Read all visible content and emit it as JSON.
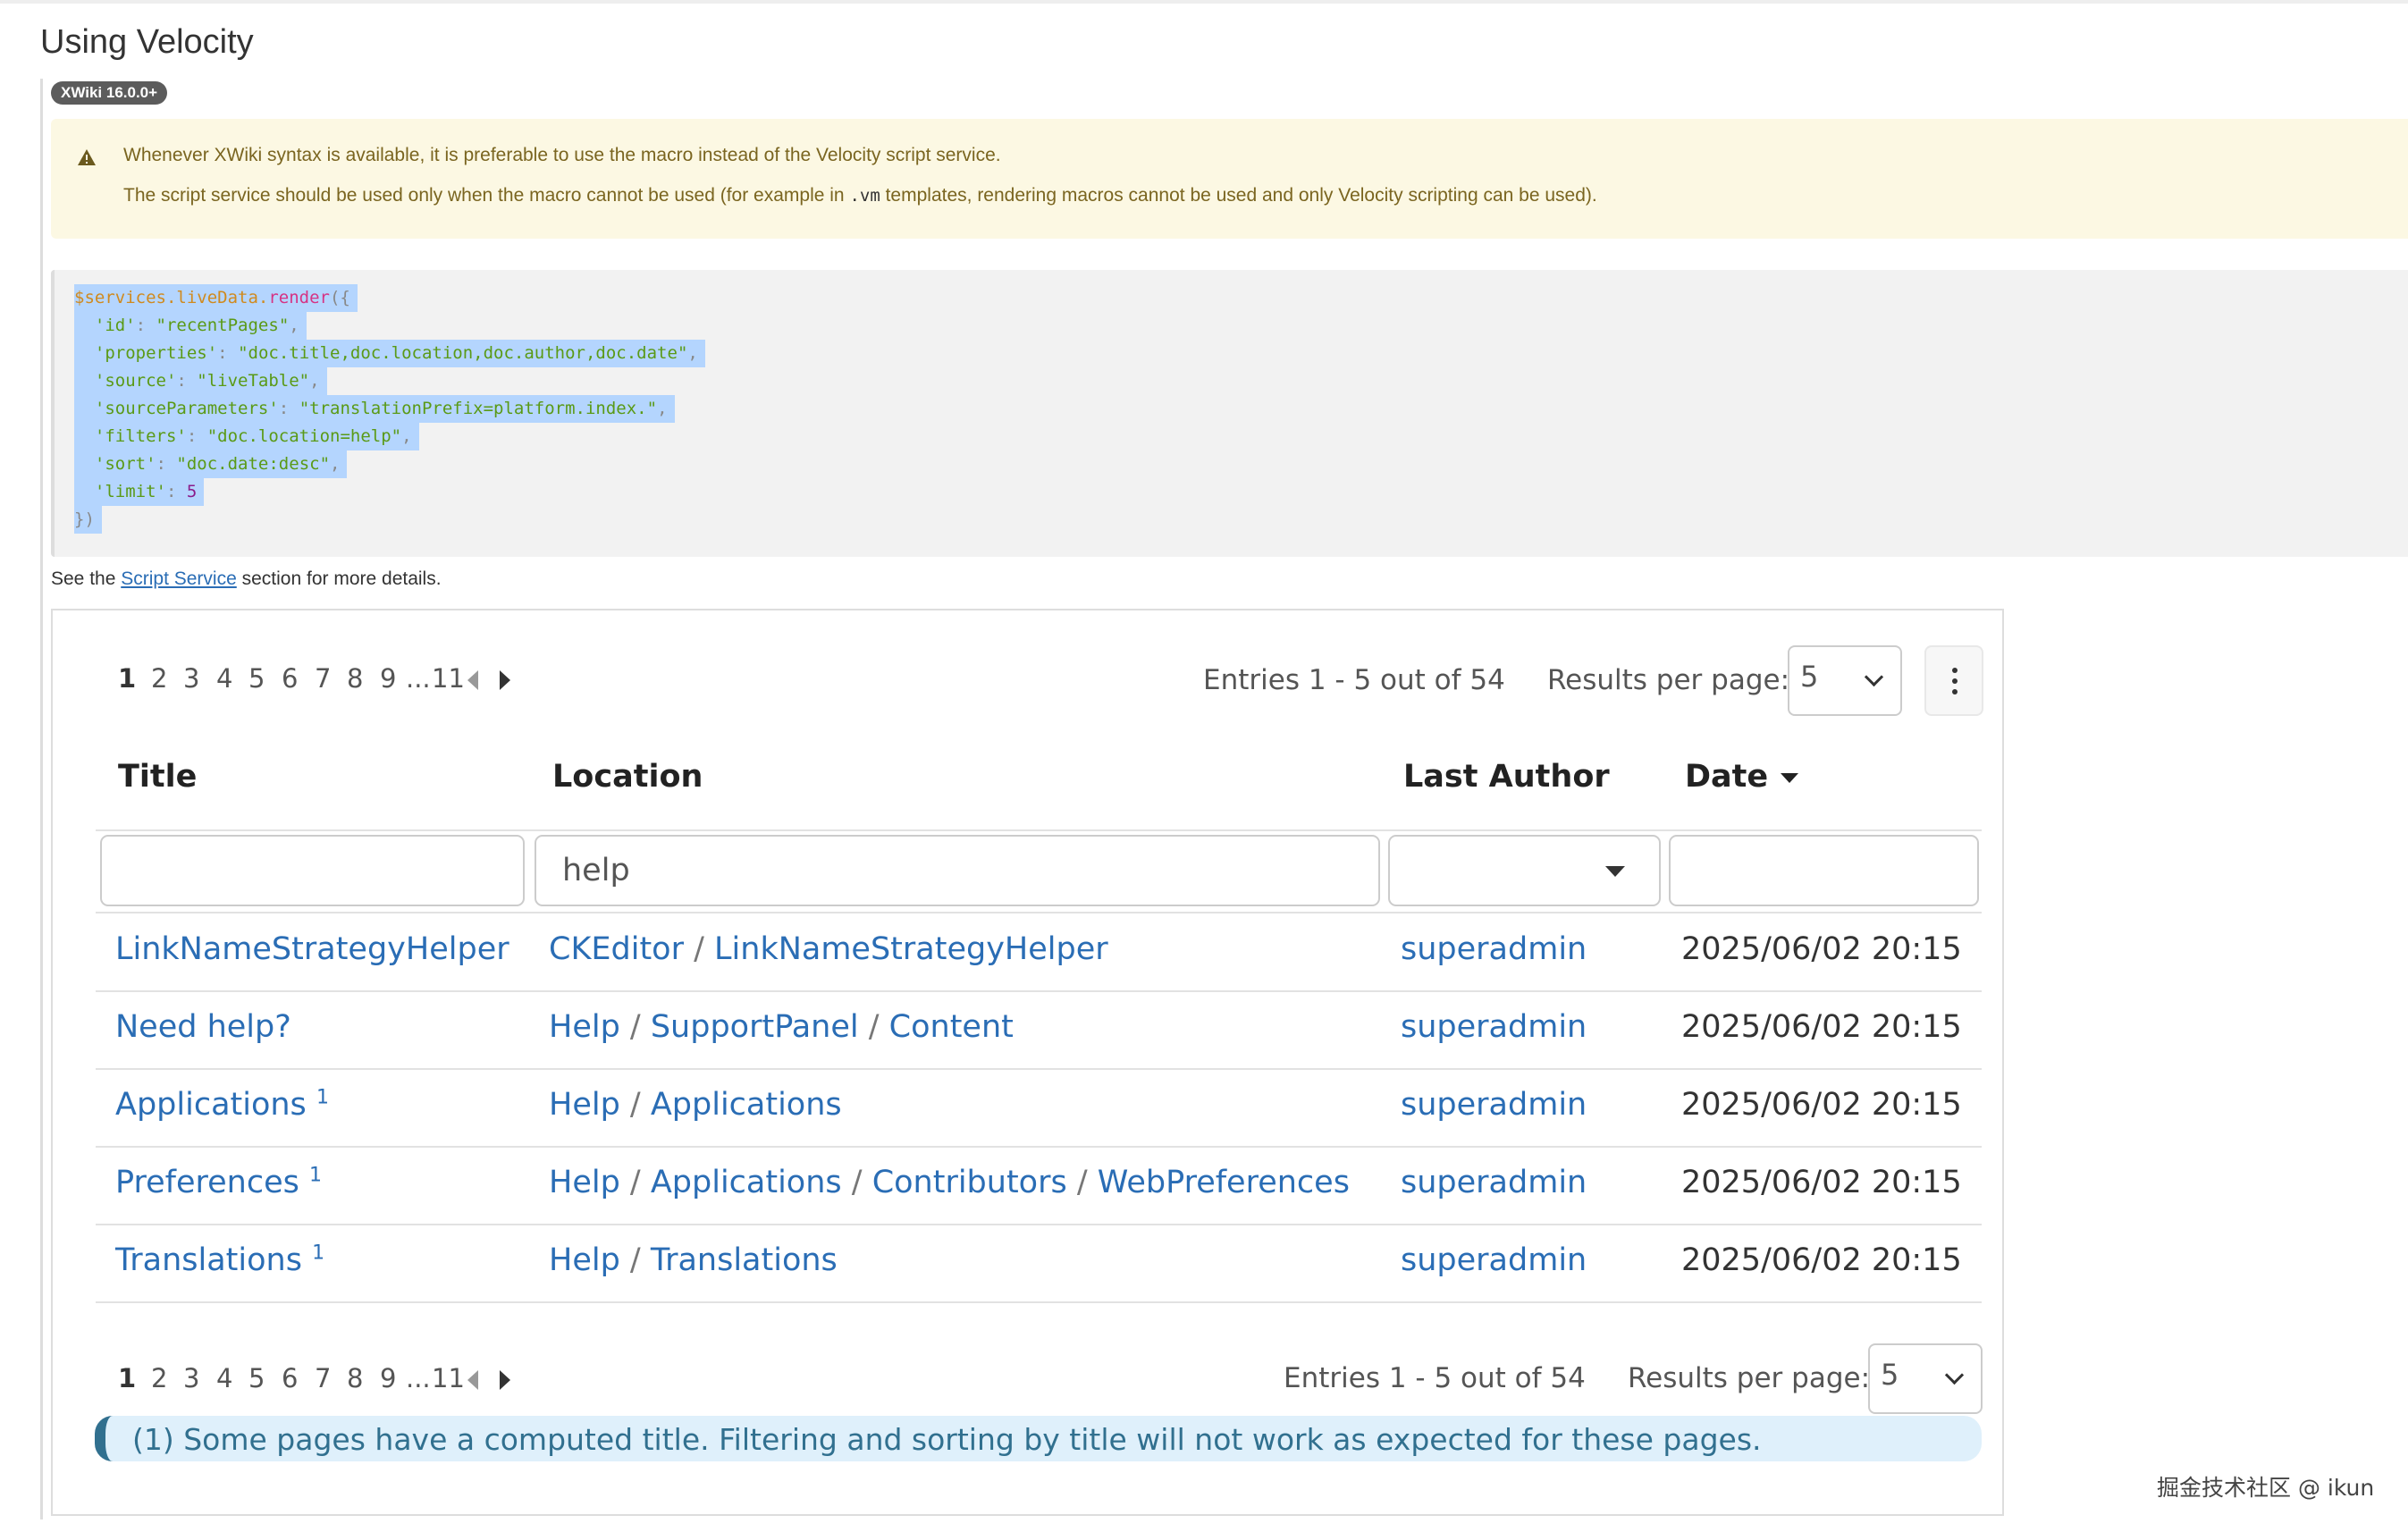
{
  "section_title": "Using Velocity",
  "version_badge": "XWiki 16.0.0+",
  "warning": {
    "line1": "Whenever XWiki syntax is available, it is preferable to use the macro instead of the Velocity script service.",
    "line2_before": "The script service should be used only when the macro cannot be used (for example in ",
    "line2_code": ".vm",
    "line2_after": " templates, rendering macros cannot be used and only Velocity scripting can be used)."
  },
  "code": {
    "var": "$services",
    "obj": ".liveData.",
    "fn": "render",
    "open": "({",
    "entries": [
      {
        "key": "'id'",
        "value": "\"recentPages\"",
        "comma": ","
      },
      {
        "key": "'properties'",
        "value": "\"doc.title,doc.location,doc.author,doc.date\"",
        "comma": ","
      },
      {
        "key": "'source'",
        "value": "\"liveTable\"",
        "comma": ","
      },
      {
        "key": "'sourceParameters'",
        "value": "\"translationPrefix=platform.index.\"",
        "comma": ","
      },
      {
        "key": "'filters'",
        "value": "\"doc.location=help\"",
        "comma": ","
      },
      {
        "key": "'sort'",
        "value": "\"doc.date:desc\"",
        "comma": ","
      },
      {
        "key": "'limit'",
        "value": "5",
        "comma": ""
      }
    ],
    "close": "})"
  },
  "see_also": {
    "before": "See the ",
    "link": "Script Service",
    "after": " section for more details."
  },
  "livedata": {
    "pages": [
      "1",
      "2",
      "3",
      "4",
      "5",
      "6",
      "7",
      "8",
      "9",
      "...",
      "11"
    ],
    "current_page": "1",
    "entries_text": "Entries 1 - 5 out of 54",
    "results_label": "Results per page:",
    "results_value": "5",
    "columns": [
      "Title",
      "Location",
      "Last Author",
      "Date"
    ],
    "filters": {
      "title": "",
      "location": "help",
      "author": "",
      "date": ""
    },
    "rows": [
      {
        "title": "LinkNameStrategyHelper",
        "footnote": "",
        "location": [
          "CKEditor",
          "LinkNameStrategyHelper"
        ],
        "author": "superadmin",
        "date": "2025/06/02 20:15"
      },
      {
        "title": "Need help?",
        "footnote": "",
        "location": [
          "Help",
          "SupportPanel",
          "Content"
        ],
        "author": "superadmin",
        "date": "2025/06/02 20:15"
      },
      {
        "title": "Applications",
        "footnote": "1",
        "location": [
          "Help",
          "Applications"
        ],
        "author": "superadmin",
        "date": "2025/06/02 20:15"
      },
      {
        "title": "Preferences",
        "footnote": "1",
        "location": [
          "Help",
          "Applications",
          "Contributors",
          "WebPreferences"
        ],
        "author": "superadmin",
        "date": "2025/06/02 20:15"
      },
      {
        "title": "Translations",
        "footnote": "1",
        "location": [
          "Help",
          "Translations"
        ],
        "author": "superadmin",
        "date": "2025/06/02 20:15"
      }
    ],
    "note": "(1) Some pages have a computed title. Filtering and sorting by title will not work as expected for these pages."
  },
  "watermark": "掘金技术社区 @ ikun"
}
